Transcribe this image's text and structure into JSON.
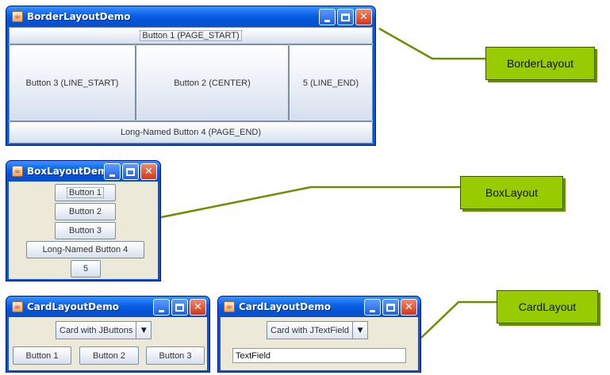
{
  "border_window": {
    "title": "BorderLayoutDemo",
    "buttons": {
      "page_start": "Button 1 (PAGE_START)",
      "line_start": "Button 3 (LINE_START)",
      "center": "Button 2 (CENTER)",
      "line_end": "5 (LINE_END)",
      "page_end": "Long-Named Button 4 (PAGE_END)"
    }
  },
  "box_window": {
    "title": "BoxLayoutDemo",
    "buttons": [
      "Button 1",
      "Button 2",
      "Button 3",
      "Long-Named Button 4",
      "5"
    ]
  },
  "card_window_1": {
    "title": "CardLayoutDemo",
    "combo_value": "Card with JButtons",
    "buttons": [
      "Button 1",
      "Button 2",
      "Button 3"
    ]
  },
  "card_window_2": {
    "title": "CardLayoutDemo",
    "combo_value": "Card with JTextField",
    "textfield_value": "TextField"
  },
  "callouts": {
    "border": "BorderLayout",
    "box": "BoxLayout",
    "card": "CardLayout"
  },
  "colors": {
    "callout_fill": "#99cc00",
    "leader_line": "#6b8e00",
    "titlebar_blue": "#0a54d6"
  },
  "icons": {
    "window_app": "java-cup-icon",
    "minimize": "minimize-icon",
    "maximize": "maximize-icon",
    "close": "close-icon",
    "combo": "chevron-down-icon"
  }
}
